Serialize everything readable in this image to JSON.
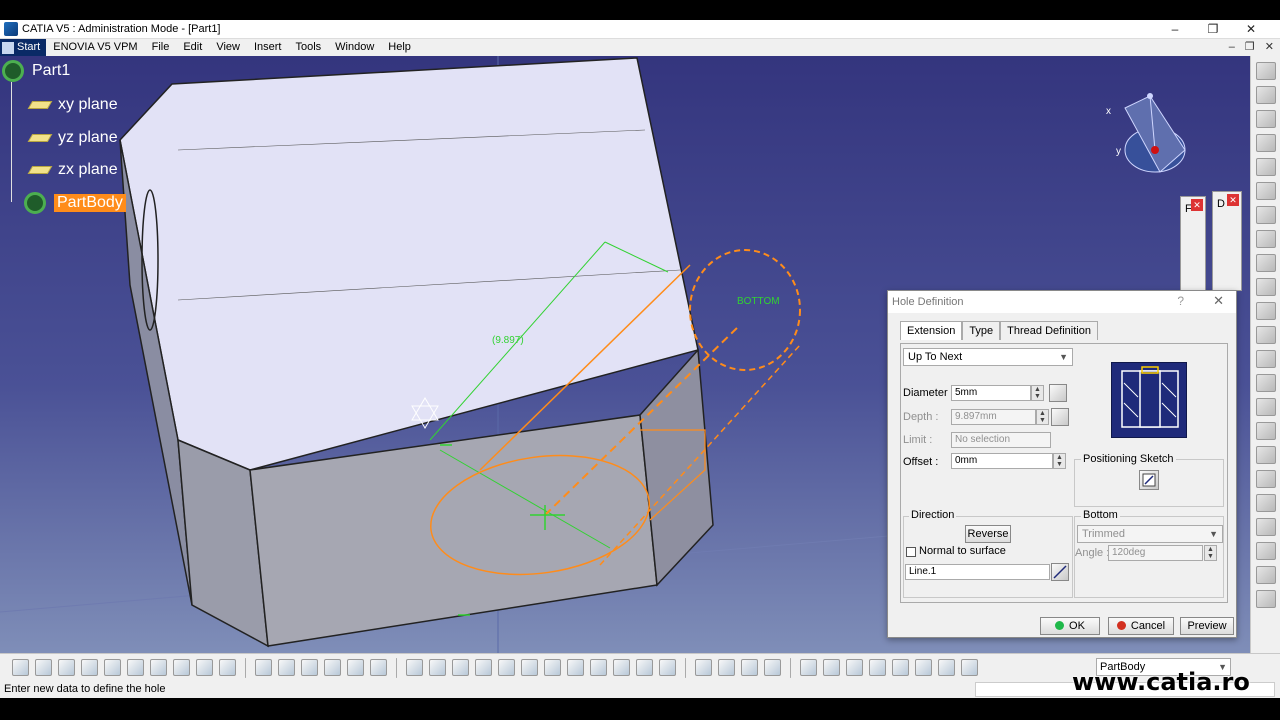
{
  "window": {
    "title": "CATIA V5 : Administration Mode - [Part1]",
    "controls": [
      "–",
      "❐",
      "✕"
    ],
    "mdi_controls": [
      "–",
      "❐",
      "✕"
    ]
  },
  "menu": {
    "start": "Start",
    "items": [
      "ENOVIA V5 VPM",
      "File",
      "Edit",
      "View",
      "Insert",
      "Tools",
      "Window",
      "Help"
    ]
  },
  "tree": {
    "root": "Part1",
    "planes": [
      "xy plane",
      "yz plane",
      "zx plane"
    ],
    "partbody": "PartBody"
  },
  "viewport": {
    "dimension_label": "(9.897)",
    "bottom_label": "BOTTOM",
    "compass": {
      "x": "x",
      "y": "y"
    },
    "mini_toolbar_1": "F",
    "mini_toolbar_2": "D"
  },
  "dialog": {
    "title": "Hole Definition",
    "help": "?",
    "close": "✕",
    "tabs": [
      "Extension",
      "Type",
      "Thread Definition"
    ],
    "extension_type": "Up To Next",
    "diameter_label": "Diameter :",
    "diameter_value": "5mm",
    "depth_label": "Depth :",
    "depth_value": "9.897mm",
    "limit_label": "Limit :",
    "limit_value": "No selection",
    "offset_label": "Offset :",
    "offset_value": "0mm",
    "positioning_sketch": "Positioning Sketch",
    "direction_title": "Direction",
    "reverse_button": "Reverse",
    "normal_to_surface": "Normal to surface",
    "direction_element": "Line.1",
    "bottom_title": "Bottom",
    "bottom_type": "Trimmed",
    "angle_label": "Angle :",
    "angle_value": "120deg",
    "ok": "OK",
    "cancel": "Cancel",
    "preview": "Preview"
  },
  "bottom_toolbar": {
    "current_body": "PartBody"
  },
  "status": {
    "message": "Enter new data to define the hole",
    "watermark": "www.catia.ro"
  },
  "colors": {
    "viewport_top": "#34357e",
    "viewport_bottom": "#7f8eb8",
    "sketch_orange": "#ff8c1a",
    "sketch_green": "#32d232",
    "partbody_highlight": "#ff8c1a"
  }
}
